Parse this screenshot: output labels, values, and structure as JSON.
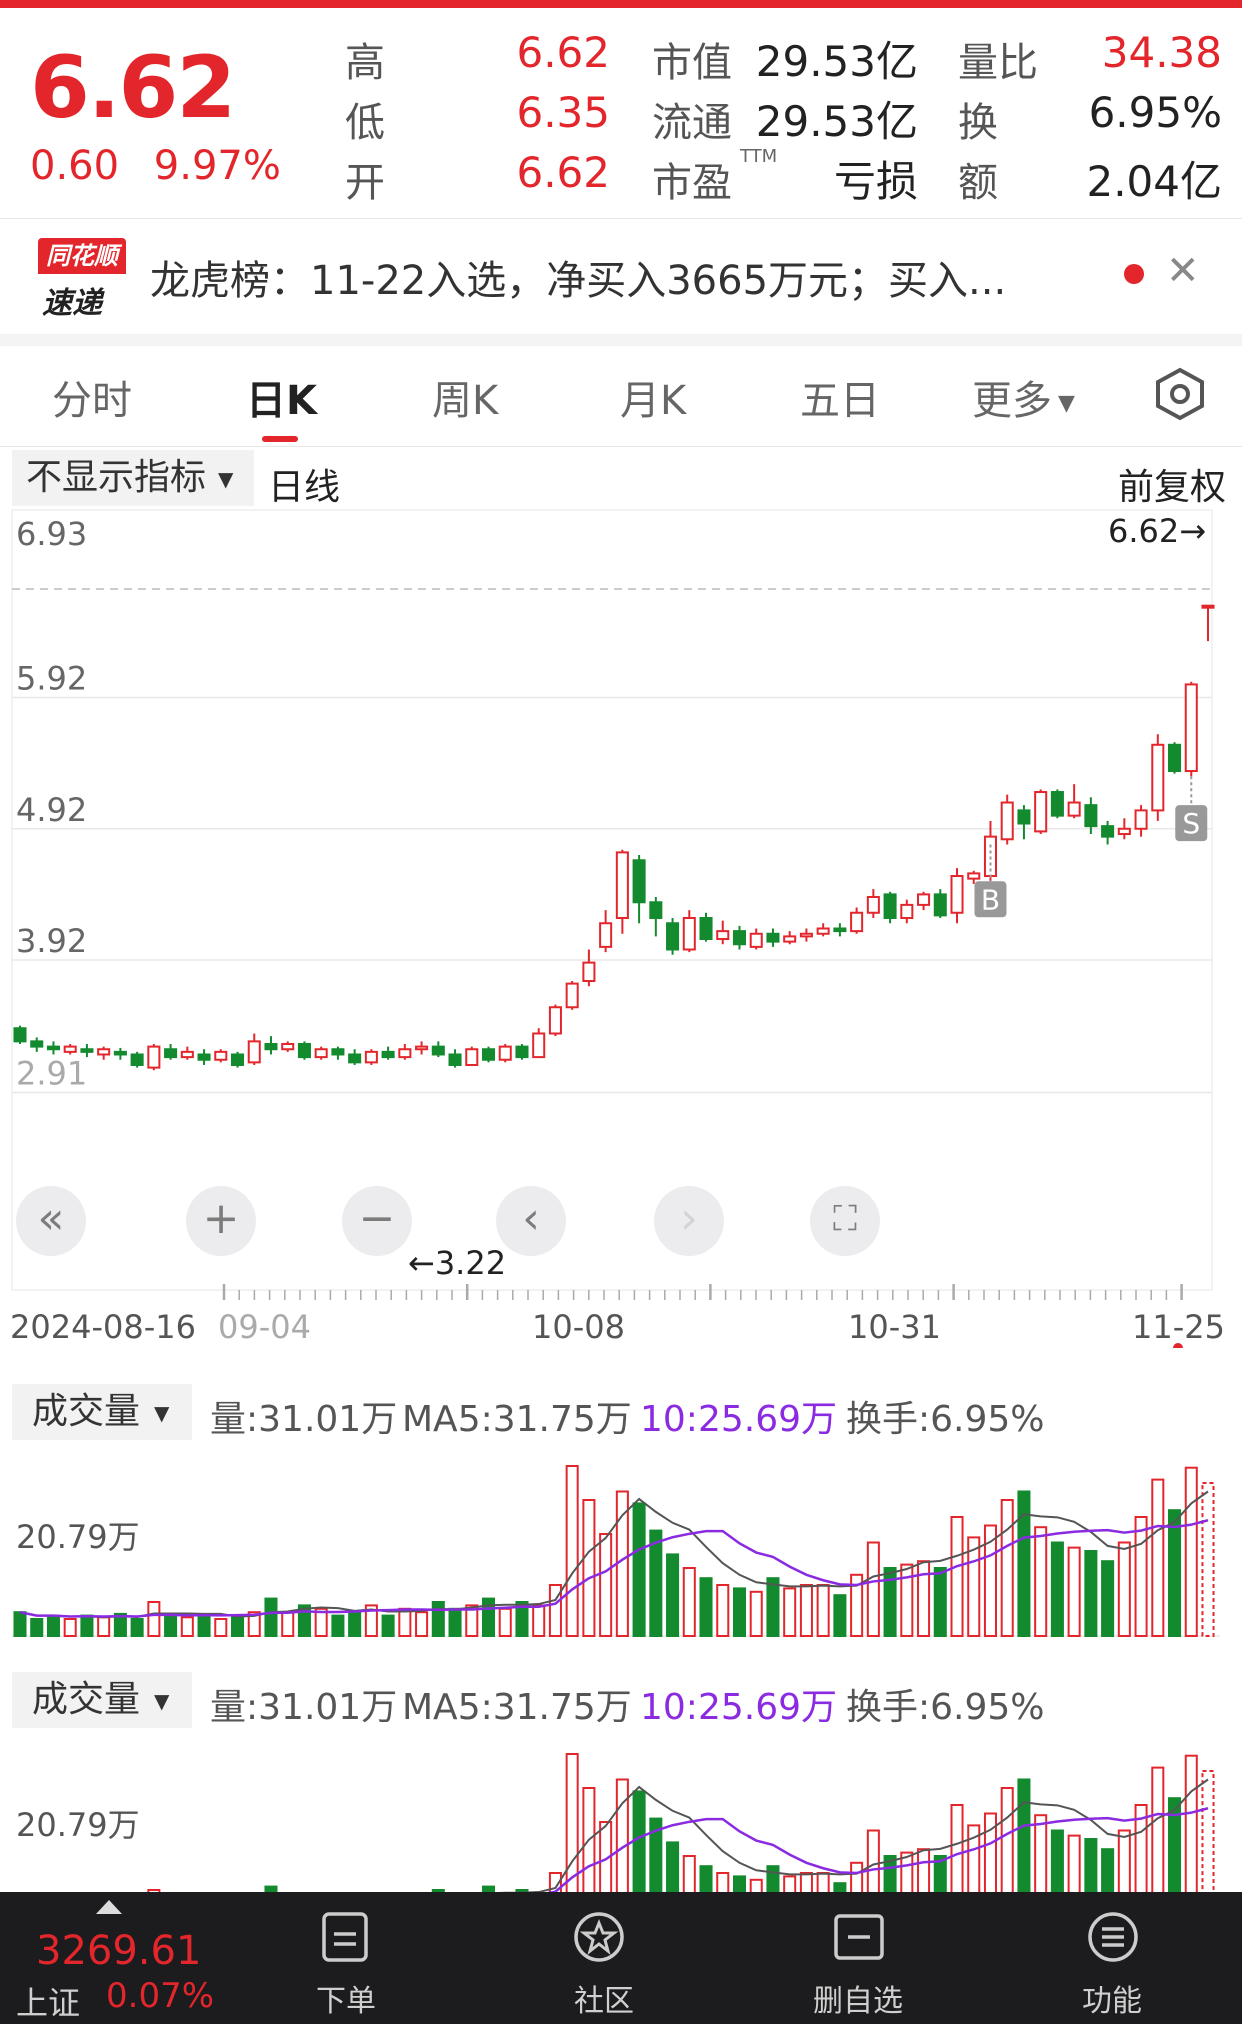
{
  "quote": {
    "price": "6.62",
    "change": "0.60",
    "change_pct": "9.97%",
    "rows": [
      {
        "l1": "高",
        "v1": "6.62",
        "l2": "市值",
        "v2": "29.53亿",
        "l3": "量比",
        "v3": "34.38"
      },
      {
        "l1": "低",
        "v1": "6.35",
        "l2": "流通",
        "v2": "29.53亿",
        "l3": "换",
        "v3": "6.95%"
      },
      {
        "l1": "开",
        "v1": "6.62",
        "l2": "市盈",
        "v2": "亏损",
        "l3": "额",
        "v3": "2.04亿"
      }
    ],
    "ttm": "TTM"
  },
  "news": {
    "logo_top": "同花顺",
    "logo_bottom": "速递",
    "text": "龙虎榜：11-22入选，净买入3665万元；买入..."
  },
  "tabs": [
    {
      "label": "分时"
    },
    {
      "label": "日K"
    },
    {
      "label": "周K"
    },
    {
      "label": "月K"
    },
    {
      "label": "五日"
    },
    {
      "label": "更多"
    }
  ],
  "subbar": {
    "indicator": "不显示指标",
    "period": "日线",
    "adjust": "前复权"
  },
  "chart_data": {
    "type": "candlestick",
    "price_ticks": [
      "6.93",
      "5.92",
      "4.92",
      "3.92",
      "2.91"
    ],
    "date_labels": [
      "2024-08-16",
      "09-04",
      "10-08",
      "10-31",
      "11-25"
    ],
    "high_marker": "6.62→",
    "low_marker": "←3.22",
    "markers": [
      "B",
      "S"
    ],
    "candles": [
      [
        3.4,
        3.3,
        3.42,
        3.28
      ],
      [
        3.3,
        3.26,
        3.33,
        3.22
      ],
      [
        3.26,
        3.24,
        3.3,
        3.2
      ],
      [
        3.22,
        3.26,
        3.28,
        3.2
      ],
      [
        3.24,
        3.22,
        3.28,
        3.18
      ],
      [
        3.2,
        3.24,
        3.26,
        3.16
      ],
      [
        3.22,
        3.2,
        3.25,
        3.16
      ],
      [
        3.2,
        3.12,
        3.22,
        3.1
      ],
      [
        3.1,
        3.26,
        3.28,
        3.08
      ],
      [
        3.24,
        3.18,
        3.28,
        3.16
      ],
      [
        3.18,
        3.22,
        3.26,
        3.16
      ],
      [
        3.2,
        3.16,
        3.24,
        3.12
      ],
      [
        3.16,
        3.22,
        3.24,
        3.14
      ],
      [
        3.2,
        3.12,
        3.22,
        3.1
      ],
      [
        3.14,
        3.3,
        3.36,
        3.12
      ],
      [
        3.28,
        3.24,
        3.34,
        3.2
      ],
      [
        3.24,
        3.28,
        3.3,
        3.22
      ],
      [
        3.28,
        3.18,
        3.3,
        3.16
      ],
      [
        3.18,
        3.24,
        3.26,
        3.16
      ],
      [
        3.24,
        3.2,
        3.26,
        3.16
      ],
      [
        3.2,
        3.14,
        3.24,
        3.12
      ],
      [
        3.14,
        3.22,
        3.24,
        3.12
      ],
      [
        3.22,
        3.18,
        3.26,
        3.16
      ],
      [
        3.18,
        3.24,
        3.28,
        3.16
      ],
      [
        3.24,
        3.26,
        3.3,
        3.2
      ],
      [
        3.26,
        3.2,
        3.3,
        3.18
      ],
      [
        3.2,
        3.12,
        3.24,
        3.1
      ],
      [
        3.12,
        3.24,
        3.26,
        3.12
      ],
      [
        3.24,
        3.16,
        3.26,
        3.14
      ],
      [
        3.16,
        3.26,
        3.28,
        3.14
      ],
      [
        3.26,
        3.18,
        3.28,
        3.16
      ],
      [
        3.18,
        3.36,
        3.4,
        3.18
      ],
      [
        3.36,
        3.56,
        3.58,
        3.34
      ],
      [
        3.56,
        3.74,
        3.76,
        3.54
      ],
      [
        3.76,
        3.9,
        4.0,
        3.72
      ],
      [
        4.02,
        4.2,
        4.3,
        3.98
      ],
      [
        4.24,
        4.74,
        4.76,
        4.12
      ],
      [
        4.68,
        4.36,
        4.72,
        4.2
      ],
      [
        4.36,
        4.24,
        4.4,
        4.1
      ],
      [
        4.2,
        4.0,
        4.24,
        3.96
      ],
      [
        4.0,
        4.24,
        4.3,
        3.98
      ],
      [
        4.24,
        4.08,
        4.28,
        4.06
      ],
      [
        4.08,
        4.14,
        4.22,
        4.04
      ],
      [
        4.14,
        4.04,
        4.18,
        4.0
      ],
      [
        4.02,
        4.12,
        4.16,
        4.0
      ],
      [
        4.12,
        4.06,
        4.16,
        4.02
      ],
      [
        4.06,
        4.1,
        4.14,
        4.04
      ],
      [
        4.1,
        4.12,
        4.16,
        4.06
      ],
      [
        4.12,
        4.16,
        4.2,
        4.1
      ],
      [
        4.16,
        4.14,
        4.2,
        4.1
      ],
      [
        4.14,
        4.28,
        4.32,
        4.12
      ],
      [
        4.28,
        4.4,
        4.46,
        4.24
      ],
      [
        4.42,
        4.24,
        4.44,
        4.2
      ],
      [
        4.24,
        4.34,
        4.38,
        4.2
      ],
      [
        4.34,
        4.42,
        4.44,
        4.3
      ],
      [
        4.42,
        4.26,
        4.46,
        4.24
      ],
      [
        4.28,
        4.56,
        4.62,
        4.2
      ],
      [
        4.54,
        4.58,
        4.6,
        4.5
      ],
      [
        4.56,
        4.86,
        4.98,
        4.52
      ],
      [
        4.84,
        5.12,
        5.18,
        4.8
      ],
      [
        5.06,
        4.96,
        5.1,
        4.84
      ],
      [
        4.9,
        5.2,
        5.22,
        4.88
      ],
      [
        5.2,
        5.02,
        5.22,
        5.0
      ],
      [
        5.02,
        5.12,
        5.26,
        5.0
      ],
      [
        5.1,
        4.94,
        5.16,
        4.88
      ],
      [
        4.94,
        4.86,
        4.98,
        4.8
      ],
      [
        4.88,
        4.92,
        5.0,
        4.84
      ],
      [
        4.92,
        5.06,
        5.1,
        4.86
      ],
      [
        5.06,
        5.56,
        5.64,
        4.98
      ],
      [
        5.56,
        5.36,
        5.58,
        5.34
      ],
      [
        5.36,
        6.02,
        6.04,
        5.32
      ],
      [
        6.62,
        6.62,
        6.62,
        6.35
      ]
    ],
    "volume_panels": [
      {
        "selector": "成交量",
        "vol": "量:31.01万",
        "ma5": "MA5:31.75万",
        "ma10": "10:25.69万",
        "turnover": "换手:6.95%",
        "axis": "20.79万"
      },
      {
        "selector": "成交量",
        "vol": "量:31.01万",
        "ma5": "MA5:31.75万",
        "ma10": "10:25.69万",
        "turnover": "换手:6.95%",
        "axis": "20.79万"
      }
    ],
    "colors": {
      "up": "#e3262b",
      "down": "#138a2e",
      "ma5": "#555555",
      "ma10": "#8a2be2"
    }
  },
  "bottom": {
    "index_value": "3269.61",
    "index_name": "上证",
    "index_pct": "0.07%",
    "items": [
      {
        "label": "下单",
        "icon": "order-icon"
      },
      {
        "label": "社区",
        "icon": "community-icon"
      },
      {
        "label": "删自选",
        "icon": "remove-watchlist-icon"
      },
      {
        "label": "功能",
        "icon": "menu-icon"
      }
    ]
  }
}
